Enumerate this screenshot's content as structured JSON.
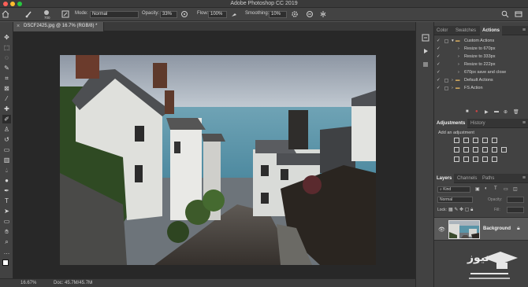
{
  "app": {
    "title": "Adobe Photoshop CC 2019"
  },
  "options": {
    "brush_size": "700",
    "mode_label": "Mode:",
    "mode_value": "Normal",
    "opacity_label": "Opacity:",
    "opacity_value": "33%",
    "flow_label": "Flow:",
    "flow_value": "100%",
    "smoothing_label": "Smoothing:",
    "smoothing_value": "10%"
  },
  "document": {
    "tab_label": "DSCF2425.jpg @ 16.7% (RGB/8) *"
  },
  "status": {
    "zoom": "16.67%",
    "doc_size": "Doc: 45.7M/45.7M"
  },
  "top_panel": {
    "tabs": [
      "Color",
      "Swatches",
      "Actions"
    ],
    "active_tab": "Actions",
    "actions": [
      {
        "label": "Custom Actions",
        "type": "folder"
      },
      {
        "label": "Resize to 670px",
        "type": "action"
      },
      {
        "label": "Resize to 333px",
        "type": "action"
      },
      {
        "label": "Resize to 222px",
        "type": "action"
      },
      {
        "label": "670px save and close",
        "type": "action"
      },
      {
        "label": "Default Actions",
        "type": "folder"
      },
      {
        "label": "FS Action",
        "type": "folder"
      }
    ]
  },
  "adjust_panel": {
    "tabs": [
      "Adjustments",
      "History"
    ],
    "active_tab": "Adjustments",
    "hint": "Add an adjustment"
  },
  "layers_panel": {
    "tabs": [
      "Layers",
      "Channels",
      "Paths"
    ],
    "active_tab": "Layers",
    "kind_label": "Kind",
    "blend_mode": "Normal",
    "opacity_label": "Opacity:",
    "lock_label": "Lock:",
    "fill_label": "Fill:",
    "layer_name": "Background"
  },
  "watermark": {
    "text": "نیوز"
  },
  "colors": {
    "accent": "#2d8cf0",
    "bg": "#535353",
    "panel": "#424242",
    "canvas": "#282828"
  }
}
